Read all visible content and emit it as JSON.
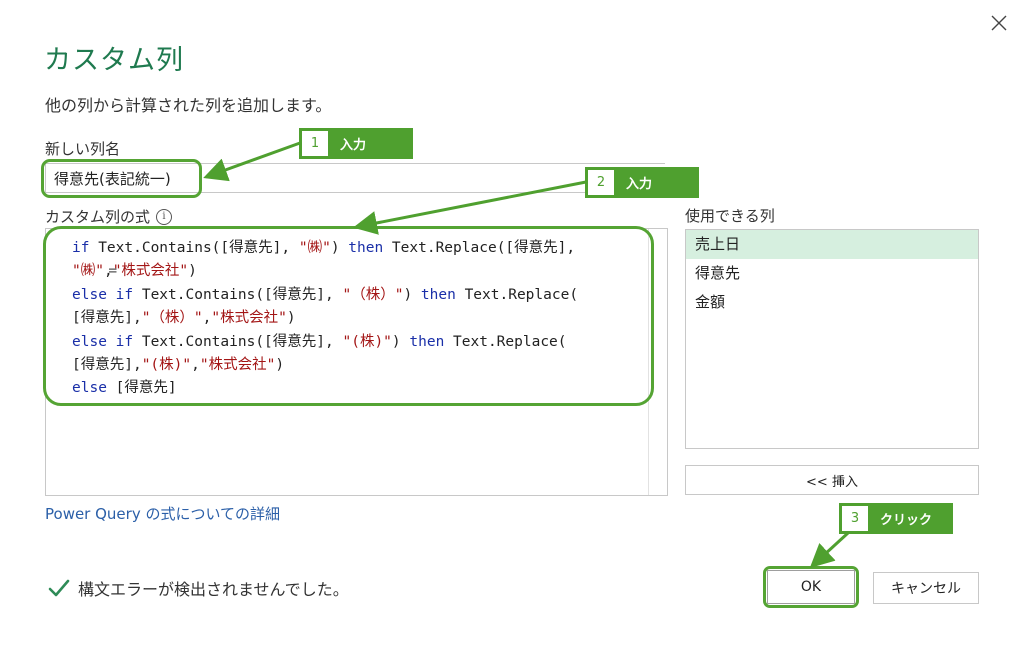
{
  "dialog": {
    "title": "カスタム列",
    "subtitle": "他の列から計算された列を追加します。"
  },
  "fields": {
    "new_column_label": "新しい列名",
    "new_column_value": "得意先(表記統一)",
    "formula_label": "カスタム列の式",
    "info_glyph": "i",
    "available_columns_label": "使用できる列"
  },
  "formula": {
    "eq": "=",
    "lines": [
      [
        [
          "kw",
          "if"
        ],
        [
          "tx",
          " Text.Contains([得意先], "
        ],
        [
          "str",
          "\"㈱\""
        ],
        [
          "tx",
          ") "
        ],
        [
          "kw",
          "then"
        ],
        [
          "tx",
          " Text.Replace([得意先],"
        ]
      ],
      [
        [
          "str",
          "\"㈱\""
        ],
        [
          "tx",
          ","
        ],
        [
          "str",
          "\"株式会社\""
        ],
        [
          "tx",
          ")"
        ]
      ],
      [
        [
          "kw",
          "else if"
        ],
        [
          "tx",
          " Text.Contains([得意先], "
        ],
        [
          "str",
          "\"（株）\""
        ],
        [
          "tx",
          ") "
        ],
        [
          "kw",
          "then"
        ],
        [
          "tx",
          " Text.Replace("
        ]
      ],
      [
        [
          "tx",
          "[得意先],"
        ],
        [
          "str",
          "\"（株）\""
        ],
        [
          "tx",
          ","
        ],
        [
          "str",
          "\"株式会社\""
        ],
        [
          "tx",
          ")"
        ]
      ],
      [
        [
          "kw",
          "else if"
        ],
        [
          "tx",
          " Text.Contains([得意先], "
        ],
        [
          "str",
          "\"(株)\""
        ],
        [
          "tx",
          ") "
        ],
        [
          "kw",
          "then"
        ],
        [
          "tx",
          " Text.Replace("
        ]
      ],
      [
        [
          "tx",
          "[得意先],"
        ],
        [
          "str",
          "\"(株)\""
        ],
        [
          "tx",
          ","
        ],
        [
          "str",
          "\"株式会社\""
        ],
        [
          "tx",
          ")"
        ]
      ],
      [
        [
          "kw",
          "else"
        ],
        [
          "tx",
          " [得意先]"
        ]
      ]
    ]
  },
  "columns": [
    {
      "label": "売上日",
      "selected": true
    },
    {
      "label": "得意先",
      "selected": false
    },
    {
      "label": "金額",
      "selected": false
    }
  ],
  "buttons": {
    "insert": "<< 挿入",
    "ok": "OK",
    "cancel": "キャンセル"
  },
  "link_text": "Power Query の式についての詳細",
  "status_text": "構文エラーが検出されませんでした。",
  "annotations": [
    {
      "num": "1",
      "text": "入力"
    },
    {
      "num": "2",
      "text": "入力"
    },
    {
      "num": "3",
      "text": "クリック"
    }
  ],
  "colors": {
    "title": "#1f7a4f",
    "annotation_green": "#4fa02f",
    "keyword": "#1a2fa8",
    "string": "#a31515",
    "selected_row": "#d6efdf",
    "link": "#2b5fa8",
    "check": "#2e8b57"
  },
  "icons": {
    "close": "close-icon",
    "status": "checkmark-icon",
    "info": "info-icon"
  }
}
